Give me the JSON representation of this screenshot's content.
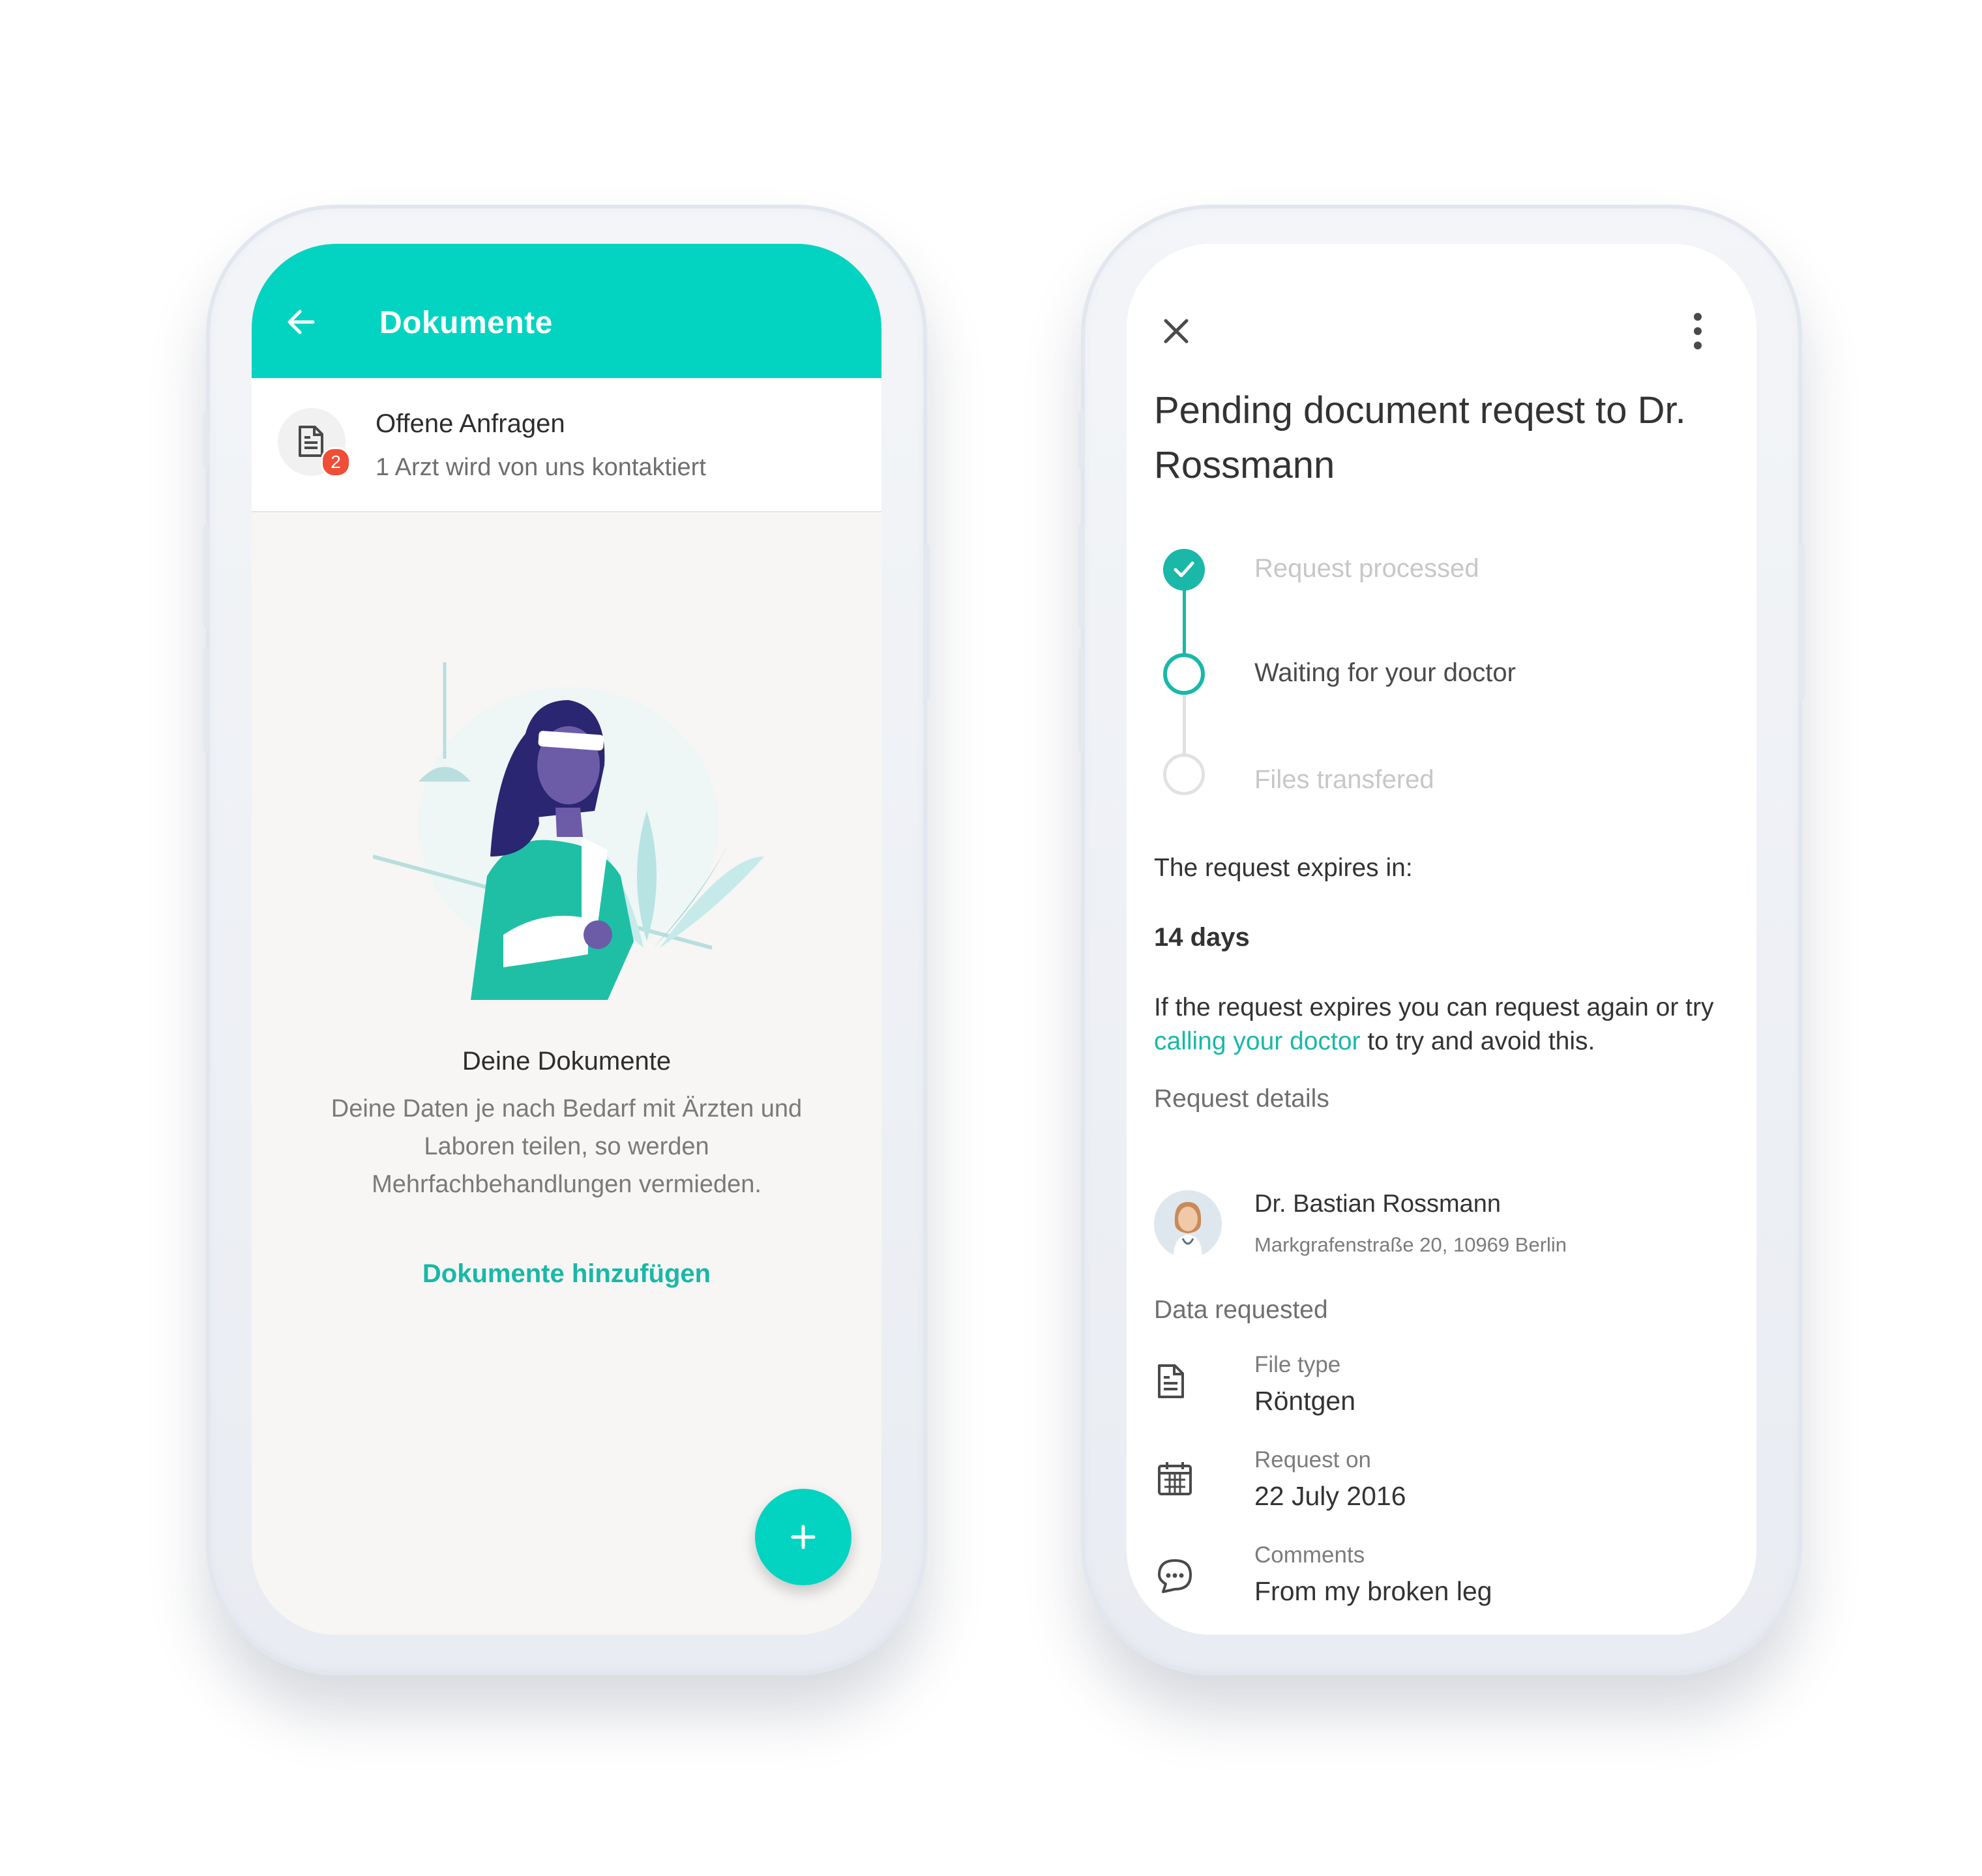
{
  "left_screen": {
    "appbar": {
      "title": "Dokumente",
      "color": "#03d4c1"
    },
    "pending": {
      "title": "Offene Anfragen",
      "subtitle": "1 Arzt wird von uns kontaktiert",
      "badge_count": "2",
      "badge_color": "#f04e37"
    },
    "empty_state": {
      "title": "Deine Dokumente",
      "description": "Deine Daten je nach Bedarf mit Ärzten und Laboren teilen, so werden Mehrfachbehandlungen vermieden.",
      "action": "Dokumente hinzufügen"
    },
    "fab_icon": "plus-icon"
  },
  "right_screen": {
    "title": "Pending document reqest to Dr. Rossmann",
    "steps": [
      {
        "label": "Request processed",
        "state": "done"
      },
      {
        "label": "Waiting for your doctor",
        "state": "current"
      },
      {
        "label": "Files transfered",
        "state": "todo"
      }
    ],
    "expires_label": "The request expires in:",
    "expires_value": "14 days",
    "info": {
      "before": "If the request expires you can request again or try ",
      "link": "calling your doctor",
      "after": " to try and avoid this."
    },
    "request_details": {
      "heading": "Request details",
      "doctor_name": "Dr. Bastian Rossmann",
      "doctor_address": "Markgrafenstraße 20, 10969 Berlin"
    },
    "data_requested": {
      "heading": "Data requested",
      "rows": [
        {
          "icon": "document-icon",
          "label": "File type",
          "value": "Röntgen"
        },
        {
          "icon": "calendar-icon",
          "label": "Request on",
          "value": "22 July 2016"
        },
        {
          "icon": "comment-icon",
          "label": "Comments",
          "value": "From my broken leg"
        }
      ]
    },
    "accent": "#19b8a8"
  }
}
